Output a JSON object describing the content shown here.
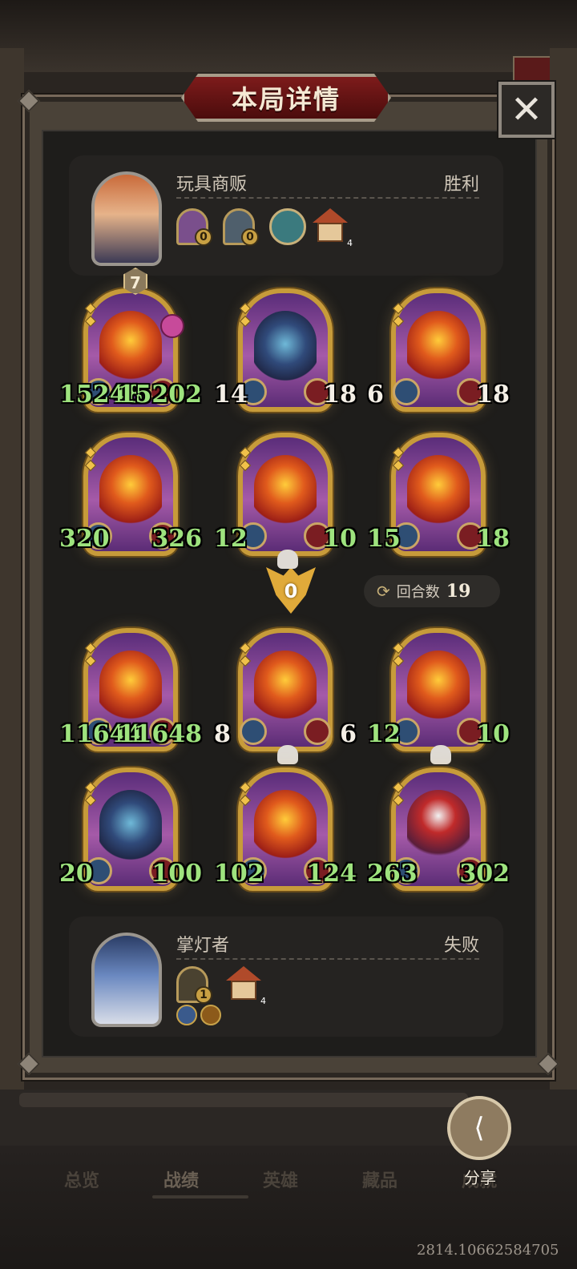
{
  "title": "本局详情",
  "close_label": "✕",
  "player_top": {
    "name": "玩具商贩",
    "result": "胜利",
    "icons": [
      {
        "name": "doll-icon",
        "count": "0",
        "color": "#7a4f8c"
      },
      {
        "name": "gear-doll-icon",
        "count": "0",
        "color": "#4f5f6c"
      }
    ],
    "house_count": "4"
  },
  "player_bottom": {
    "name": "掌灯者",
    "result": "失败",
    "icons": [
      {
        "name": "lantern-icon",
        "count": "1",
        "color": "#4a4230"
      }
    ],
    "house_count": "4"
  },
  "top_cards": [
    {
      "atk": "15248",
      "hp": "15202",
      "art": "fire",
      "green_atk": true,
      "green_hp": true,
      "tier": "7"
    },
    {
      "atk": "14",
      "hp": "18",
      "art": "dark",
      "green_atk": false,
      "green_hp": false
    },
    {
      "atk": "6",
      "hp": "18",
      "art": "fire",
      "green_atk": false,
      "green_hp": false
    },
    {
      "atk": "320",
      "hp": "326",
      "art": "fire",
      "green_atk": true,
      "green_hp": true
    },
    {
      "atk": "12",
      "hp": "10",
      "art": "fire",
      "green_atk": true,
      "green_hp": true
    },
    {
      "atk": "15",
      "hp": "18",
      "art": "fire",
      "green_atk": true,
      "green_hp": true
    }
  ],
  "bottom_cards": [
    {
      "atk": "11644",
      "hp": "11648",
      "art": "fire",
      "green_atk": true,
      "green_hp": true
    },
    {
      "atk": "8",
      "hp": "6",
      "art": "fire",
      "green_atk": false,
      "green_hp": false
    },
    {
      "atk": "12",
      "hp": "10",
      "art": "fire",
      "green_atk": true,
      "green_hp": true
    },
    {
      "atk": "20",
      "hp": "100",
      "art": "dark",
      "green_atk": true,
      "green_hp": true
    },
    {
      "atk": "102",
      "hp": "124",
      "art": "fire",
      "green_atk": true,
      "green_hp": true
    },
    {
      "atk": "263",
      "hp": "302",
      "art": "clown",
      "green_atk": true,
      "green_hp": true
    }
  ],
  "damage_value": "0",
  "rounds": {
    "label": "回合数",
    "value": "19"
  },
  "tabs": [
    "总览",
    "战绩",
    "英雄",
    "藏品",
    "成就"
  ],
  "active_tab": 1,
  "share_label": "分享",
  "watermark": "2814.10662584705",
  "colors": {
    "accent_gold": "#c79b3a",
    "title_red": "#7d1b1b",
    "stat_green": "#9ee37e"
  }
}
